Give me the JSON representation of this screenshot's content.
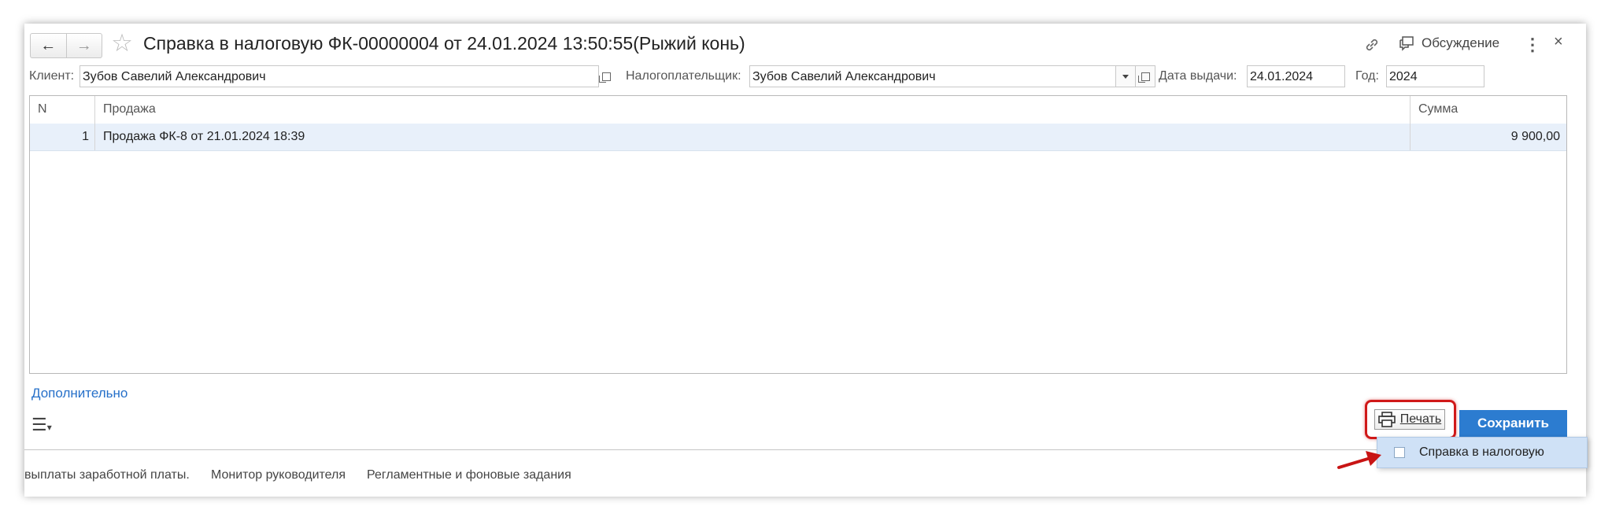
{
  "header": {
    "title": "Справка в налоговую ФК-00000004 от 24.01.2024 13:50:55(Рыжий конь)",
    "back_icon": "←",
    "forward_icon": "→",
    "discussion_label": "Обсуждение",
    "more_icon": "⋮",
    "close_icon": "×"
  },
  "form": {
    "client_label": "Клиент:",
    "client_value": "Зубов Савелий Александрович",
    "taxpayer_label": "Налогоплательщик:",
    "taxpayer_value": "Зубов Савелий Александрович",
    "issue_date_label": "Дата выдачи:",
    "issue_date_value": "24.01.2024",
    "year_label": "Год:",
    "year_value": "2024"
  },
  "table": {
    "columns": [
      "N",
      "Продажа",
      "Сумма"
    ],
    "rows": [
      {
        "n": "1",
        "sale": "Продажа ФК-8 от 21.01.2024 18:39",
        "sum": "9 900,00"
      }
    ]
  },
  "footer": {
    "additional_link": "Дополнительно",
    "print_label": "Печать",
    "save_label": "Сохранить"
  },
  "print_menu": {
    "items": [
      "Справка в налоговую"
    ]
  },
  "bottom_links": [
    "выплаты заработной платы.",
    "Монитор руководителя",
    "Регламентные и фоновые задания"
  ],
  "colors": {
    "accent": "#2c7cd0",
    "highlight": "#d01818",
    "selected_row": "#e8f0fa",
    "link": "#2670c9"
  }
}
